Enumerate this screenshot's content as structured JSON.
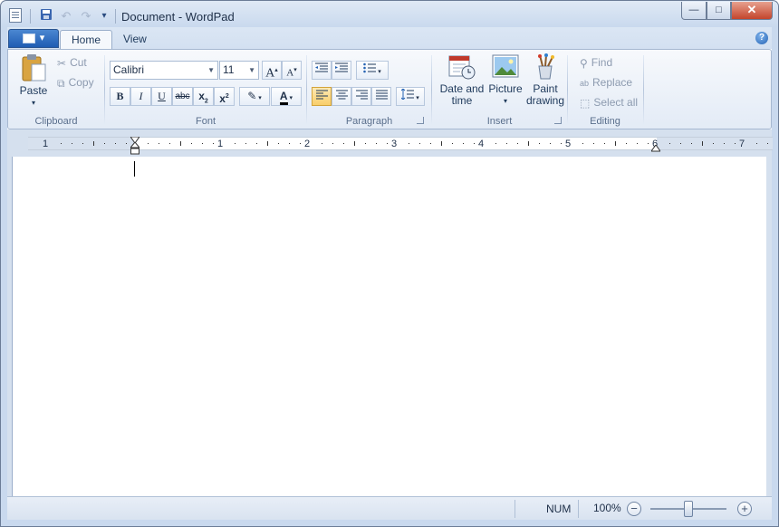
{
  "window": {
    "title": "Document - WordPad",
    "minimize": "—",
    "maximize": "□",
    "close": "✕"
  },
  "qat": {
    "save_icon": "save-icon",
    "undo_icon": "undo-icon",
    "redo_icon": "redo-icon",
    "customize": "▾"
  },
  "tabs": [
    {
      "label": "Home",
      "active": true
    },
    {
      "label": "View",
      "active": false
    }
  ],
  "help": "?",
  "ribbon": {
    "clipboard": {
      "label": "Clipboard",
      "paste": "Paste",
      "cut": "Cut",
      "copy": "Copy"
    },
    "font": {
      "label": "Font",
      "family": "Calibri",
      "size": "11",
      "grow": "A",
      "shrink": "A",
      "bold": "B",
      "italic": "I",
      "underline": "U",
      "strike": "abc",
      "subscript": "x",
      "superscript": "x",
      "color_letter": "A"
    },
    "paragraph": {
      "label": "Paragraph"
    },
    "insert": {
      "label": "Insert",
      "datetime": [
        "Date and",
        "time"
      ],
      "picture": "Picture",
      "paint": [
        "Paint",
        "drawing"
      ]
    },
    "editing": {
      "label": "Editing",
      "find": "Find",
      "replace": "Replace",
      "select_all": "Select all"
    }
  },
  "ruler": {
    "labels": [
      "1",
      "1",
      "2",
      "3",
      "4",
      "5",
      "6",
      "7"
    ]
  },
  "status": {
    "num": "NUM",
    "zoom": "100%",
    "zoom_out": "−",
    "zoom_in": "+"
  },
  "colors": {
    "accent": "#1f5cb3",
    "font_color": "#000000",
    "highlight": "#ffffff"
  }
}
